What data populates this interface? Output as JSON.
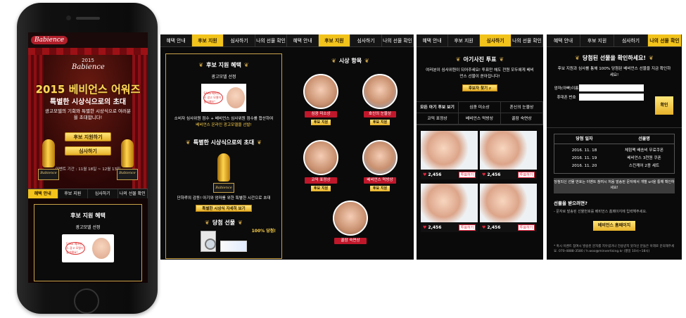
{
  "phone": {
    "logo": "Babience",
    "badge_year": "2015",
    "badge_brand": "Babience",
    "headline": "2015 베비언스 어워즈",
    "subheadline": "특별한 시상식으로의 초대",
    "description": "광고모델의 기회와 특별한 시상식으로 여러분을 초대합니다!",
    "btn_support": "후보 지원하기",
    "btn_judge": "심사하기",
    "event_period": "이벤트 기간 : 11월 18일 ~ 12월 13일",
    "trophy_label": "Babience",
    "tabs": [
      "혜택 안내",
      "후보 지원",
      "심사하기",
      "나의 선물 확인"
    ],
    "card_title": "후보 지원 혜택",
    "card_sub": "광고모델 선정",
    "bubble_text": "SAKE 베비언스 광고 모델이 될거예요!"
  },
  "panel1": {
    "tabs": [
      "혜택 안내",
      "후보 지원",
      "심사하기",
      "나의 선물 확인"
    ],
    "active_tab": 1,
    "sec1_title": "후보 지원 혜택",
    "sec1_sub": "광고모델 선정",
    "sec1_text": "소비자 심사위원 점수 + 베비언스 심사위원 점수를 합산하여",
    "sec1_highlight": "베비언스 온라인 광고모델을 선발!",
    "sec2_title": "특별한 시상식으로의 초대",
    "trophy_label": "Babience",
    "sec2_text": "단하루의 감동! 아기와 엄마를 위한 특별한 시간으로 초대",
    "sec2_btn": "특별한 시상식 자세히 보기",
    "sec3_title": "당첨 선물",
    "percent": "100% 당첨!"
  },
  "panel2": {
    "tabs": [
      "혜택 안내",
      "후보 지원",
      "심사하기",
      "나의 선물 확인"
    ],
    "active_tab": 1,
    "title": "시상 항목",
    "support_label": "후보 지원",
    "awards": [
      "심쿵 미소상",
      "호신의 눈물상",
      "코믹 표정상",
      "베비언스 먹방상",
      "꿀잠 숙면상"
    ]
  },
  "panel3": {
    "tabs": [
      "혜택 안내",
      "후보 지원",
      "심사하기",
      "나의 선물 확인"
    ],
    "active_tab": 2,
    "title": "아기사진 투표",
    "desc": "여러분이 심사위원이 되어주세요! 투표만 해도 전원 모두에게 베비언스 선물이 쏟아집니다!",
    "find_btn": "후보자 찾기",
    "subtabs": [
      "모든 아기 후보 보기",
      "심쿵 미소상",
      "혼신의 눈물상",
      "코믹 표정상",
      "베비언스 먹방상",
      "꿀잠 숙면상"
    ],
    "photos": [
      {
        "likes": "2,456",
        "vote": "투표하기"
      },
      {
        "likes": "2,456",
        "vote": "투표하기"
      },
      {
        "likes": "2,456",
        "vote": "투표하기"
      },
      {
        "likes": "2,456",
        "vote": "투표하기"
      }
    ]
  },
  "panel4": {
    "tabs": [
      "혜택 안내",
      "후보 지원",
      "심사하기",
      "나의 선물 확인"
    ],
    "active_tab": 3,
    "title": "당첨된 선물을 확인하세요!",
    "desc": "후보 지원과 심사를 통해 100% 당첨된 베비언스 선물을 지금 확인하세요!",
    "name_label": "엄마(아빠)이름",
    "phone_label": "휴대폰 번호",
    "confirm_btn": "확인",
    "table_headers": [
      "당첨 일자",
      "선물명"
    ],
    "rows": [
      {
        "date": "2016. 11. 18",
        "gift": "체험팩 배송비 무료쿠폰"
      },
      {
        "date": "2016. 11. 19",
        "gift": "베비언스 3천원 쿠폰"
      },
      {
        "date": "2016. 11. 20",
        "gift": "스킨케어 2종 세트"
      }
    ],
    "notice": "당첨되신 선물 번호는 이벤트 참여시 처음 발송된 문자에서 개별 url을 통해 확인하세요!",
    "receive_q": "선물을 받으려면?",
    "receive_a": "- 문자로 발송된 선물번호를 베비언스 홈페이지에 입력해주세요.",
    "home_btn": "베비언스 홈페이지",
    "footnote": "* 혹시 이벤트 참여시 발송된 문자를 지우셨거나 전송받지 못하신 분들은 아래로 문의해주세요. 070-4888-3580 / h.woo@minvertising.kr (평일 10시~18시)"
  }
}
